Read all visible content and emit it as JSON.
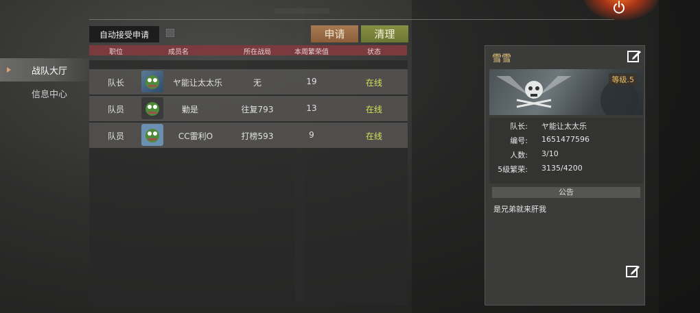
{
  "header": {
    "auto_accept_label": "自动接受申请",
    "apply_label": "申请",
    "clean_label": "清理",
    "power_icon": "power-icon"
  },
  "sidebar": {
    "items": [
      {
        "label": "战队大厅",
        "active": true
      },
      {
        "label": "信息中心",
        "active": false
      }
    ]
  },
  "table": {
    "columns": [
      "职位",
      "成员名",
      "所在战局",
      "本周繁荣值",
      "状态"
    ],
    "rows": [
      {
        "role": "队长",
        "name": "ヤ能让太太乐",
        "battle": "无",
        "prosperity": "19",
        "status": "在线"
      },
      {
        "role": "队员",
        "name": "勦是",
        "battle": "往复793",
        "prosperity": "13",
        "status": "在线"
      },
      {
        "role": "队员",
        "name": "CC雷利O",
        "battle": "打榜593",
        "prosperity": "9",
        "status": "在线"
      }
    ]
  },
  "team": {
    "name": "雪雪",
    "level": "等级.5",
    "info": [
      {
        "key": "队长:",
        "value": "ヤ能让太太乐"
      },
      {
        "key": "编号:",
        "value": "1651477596"
      },
      {
        "key": "人数:",
        "value": "3/10"
      },
      {
        "key": "5级繁荣:",
        "value": "3135/4200"
      }
    ],
    "notice_title": "公告",
    "notice_text": "是兄弟就来肝我"
  },
  "colors": {
    "accent_gold": "#e3c07a",
    "status_green": "#d8e05a",
    "apply_btn": "#a77a52",
    "clean_btn": "#869144",
    "table_header": "#7a3a3e"
  }
}
